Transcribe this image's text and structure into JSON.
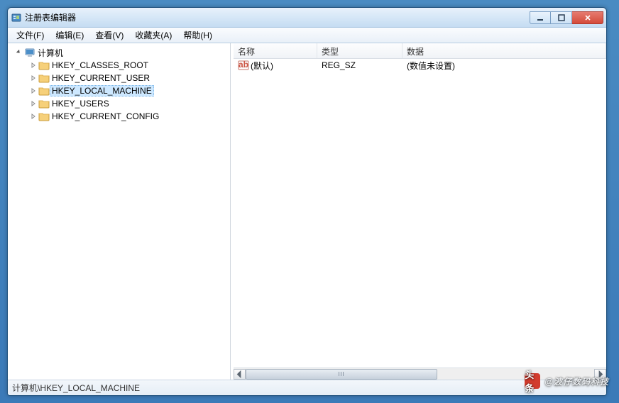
{
  "window": {
    "title": "注册表编辑器"
  },
  "menu": {
    "file": "文件(F)",
    "edit": "编辑(E)",
    "view": "查看(V)",
    "favorites": "收藏夹(A)",
    "help": "帮助(H)"
  },
  "tree": {
    "root": "计算机",
    "hives": [
      {
        "name": "HKEY_CLASSES_ROOT",
        "selected": false
      },
      {
        "name": "HKEY_CURRENT_USER",
        "selected": false
      },
      {
        "name": "HKEY_LOCAL_MACHINE",
        "selected": true
      },
      {
        "name": "HKEY_USERS",
        "selected": false
      },
      {
        "name": "HKEY_CURRENT_CONFIG",
        "selected": false
      }
    ]
  },
  "list": {
    "columns": {
      "name": "名称",
      "type": "类型",
      "data": "数据"
    },
    "rows": [
      {
        "name": "(默认)",
        "type": "REG_SZ",
        "data": "(数值未设置)"
      }
    ]
  },
  "statusbar": {
    "path": "计算机\\HKEY_LOCAL_MACHINE"
  },
  "watermark": {
    "prefix": "头条",
    "text": "@波仔数码科技"
  }
}
